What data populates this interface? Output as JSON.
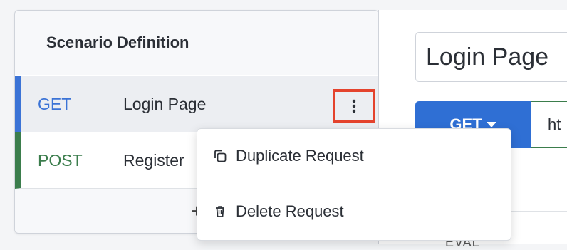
{
  "scenario": {
    "header": "Scenario Definition",
    "requests": [
      {
        "method": "GET",
        "name": "Login Page",
        "color": "#3b73d6",
        "selected": true
      },
      {
        "method": "POST",
        "name": "Register",
        "color": "#3b7d4c",
        "selected": false
      }
    ],
    "add_label": "+"
  },
  "editor": {
    "title_value": "Login Page",
    "method_label": "GET",
    "url_value": "ht",
    "truncated_label": "EVAL"
  },
  "context_menu": {
    "items": [
      {
        "label": "Duplicate Request",
        "icon": "duplicate-icon"
      },
      {
        "label": "Delete Request",
        "icon": "trash-icon"
      }
    ]
  },
  "colors": {
    "accent": "#2f6fd4",
    "highlight_box": "#e4432d"
  }
}
